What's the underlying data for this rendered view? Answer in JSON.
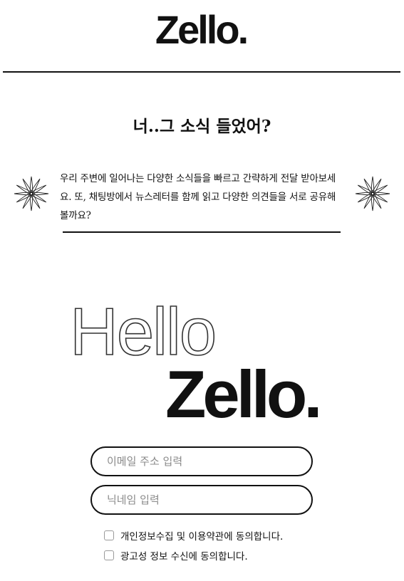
{
  "brand": {
    "logo_text": "Zello",
    "logo_dot": "."
  },
  "hero": {
    "headline": "너..그 소식 들었어?",
    "intro": "우리 주변에 일어나는 다양한 소식들을 빠르고 간략하게 전달 받아보세요. 또, 채팅방에서 뉴스레터를 함께 읽고 다양한 의견들을 서로 공유해볼까요?"
  },
  "signup": {
    "hello_text": "Hello",
    "logo_text": "Zello",
    "logo_dot": ".",
    "email_placeholder": "이메일 주소 입력",
    "email_value": "",
    "nickname_placeholder": "닉네임 입력",
    "nickname_value": "",
    "consent_privacy": "개인정보수집 및 이용약관에 동의합니다.",
    "consent_ads": "광고성 정보 수신에 동의합니다.",
    "consent_privacy_checked": false,
    "consent_ads_checked": false
  },
  "icons": {
    "decor_left": "starburst-icon",
    "decor_right": "starburst-icon"
  },
  "colors": {
    "text": "#111111",
    "background": "#ffffff",
    "placeholder": "#8a8a8a",
    "checkbox_border": "#9a9a9a"
  }
}
